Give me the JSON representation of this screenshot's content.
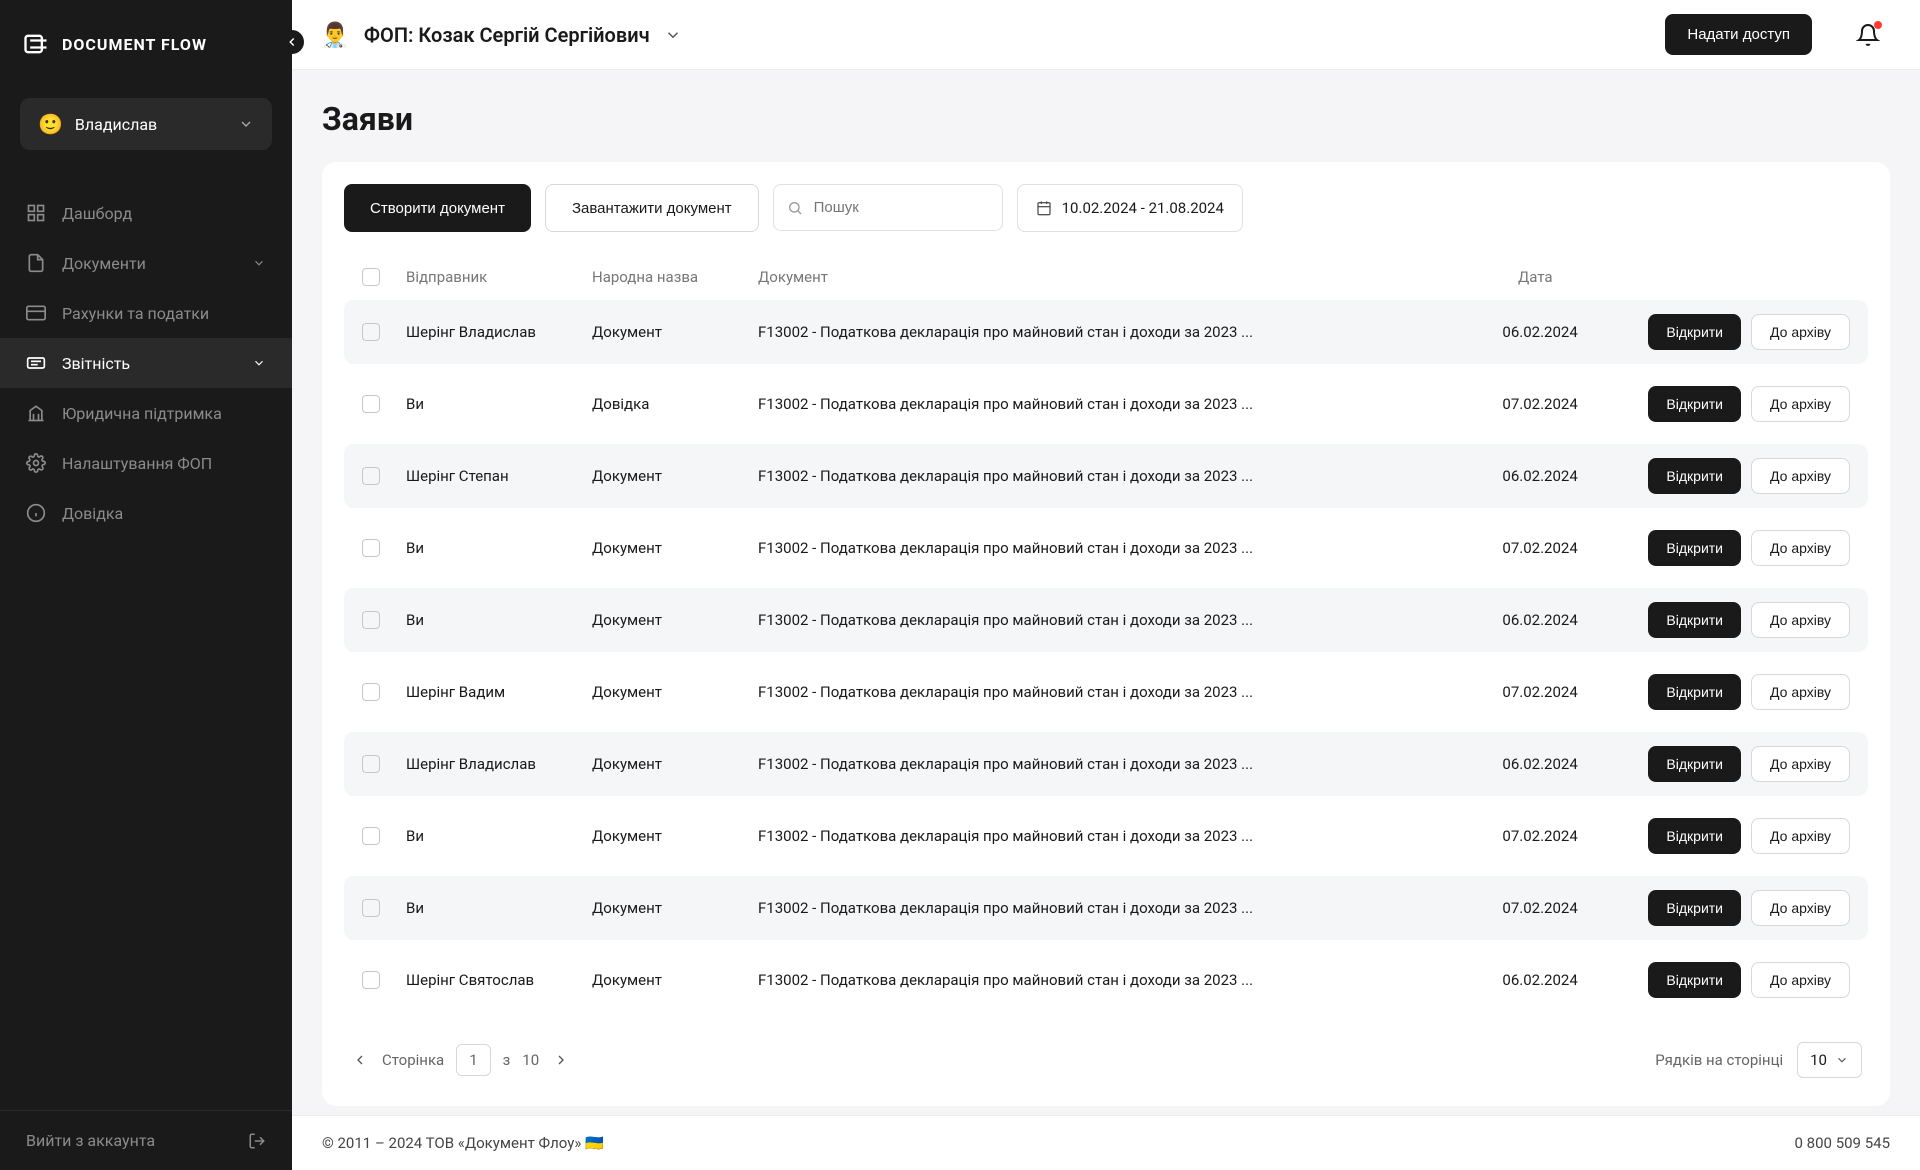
{
  "brand": "DOCUMENT FLOW",
  "user": {
    "emoji": "🙂",
    "name": "Владислав"
  },
  "nav": [
    {
      "icon": "dashboard",
      "label": "Дашборд"
    },
    {
      "icon": "documents",
      "label": "Документи",
      "expandable": true
    },
    {
      "icon": "billing",
      "label": "Рахунки та податки"
    },
    {
      "icon": "reports",
      "label": "Звітність",
      "active": true,
      "expandable": true
    },
    {
      "icon": "legal",
      "label": "Юридична підтримка"
    },
    {
      "icon": "settings",
      "label": "Налаштування ФОП"
    },
    {
      "icon": "help",
      "label": "Довідка"
    }
  ],
  "logout": "Вийти з аккаунта",
  "topbar": {
    "org_emoji": "👨‍⚕️",
    "org_name": "ФОП: Козак Сергій Сергійович",
    "grant_access": "Надати доступ"
  },
  "page": {
    "title": "Заяви"
  },
  "toolbar": {
    "create": "Створити документ",
    "upload": "Завантажити документ",
    "search_placeholder": "Пошук",
    "date_range": "10.02.2024 - 21.08.2024"
  },
  "table": {
    "headers": {
      "sender": "Відправник",
      "type": "Народна назва",
      "doc": "Документ",
      "date": "Дата"
    },
    "open_label": "Відкрити",
    "archive_label": "До архіву",
    "rows": [
      {
        "sender": "Шерінг Владислав",
        "type": "Документ",
        "doc": "F13002 - Податкова декларація про майновий стан і доходи за 2023 ...",
        "date": "06.02.2024"
      },
      {
        "sender": "Ви",
        "type": "Довідка",
        "doc": "F13002 - Податкова декларація про майновий стан і доходи за 2023 ...",
        "date": "07.02.2024"
      },
      {
        "sender": "Шерінг Степан",
        "type": "Документ",
        "doc": "F13002 - Податкова декларація про майновий стан і доходи за 2023 ...",
        "date": "06.02.2024"
      },
      {
        "sender": "Ви",
        "type": "Документ",
        "doc": "F13002 - Податкова декларація про майновий стан і доходи за 2023 ...",
        "date": "07.02.2024"
      },
      {
        "sender": "Ви",
        "type": "Документ",
        "doc": "F13002 - Податкова декларація про майновий стан і доходи за 2023 ...",
        "date": "06.02.2024"
      },
      {
        "sender": "Шерінг Вадим",
        "type": "Документ",
        "doc": "F13002 - Податкова декларація про майновий стан і доходи за 2023 ...",
        "date": "07.02.2024"
      },
      {
        "sender": "Шерінг Владислав",
        "type": "Документ",
        "doc": "F13002 - Податкова декларація про майновий стан і доходи за 2023 ...",
        "date": "06.02.2024"
      },
      {
        "sender": "Ви",
        "type": "Документ",
        "doc": "F13002 - Податкова декларація про майновий стан і доходи за 2023 ...",
        "date": "07.02.2024"
      },
      {
        "sender": "Ви",
        "type": "Документ",
        "doc": "F13002 - Податкова декларація про майновий стан і доходи за 2023 ...",
        "date": "07.02.2024"
      },
      {
        "sender": "Шерінг Святослав",
        "type": "Документ",
        "doc": "F13002 - Податкова декларація про майновий стан і доходи за 2023 ...",
        "date": "06.02.2024"
      }
    ]
  },
  "pagination": {
    "page_label": "Сторінка",
    "current": "1",
    "of": "з",
    "total": "10",
    "rows_label": "Рядків на сторінці",
    "rows_value": "10"
  },
  "footer": {
    "copyright": "© 2011 – 2024 ТОВ «Документ Флоу»",
    "flag": "🇺🇦",
    "phone": "0 800 509 545"
  }
}
